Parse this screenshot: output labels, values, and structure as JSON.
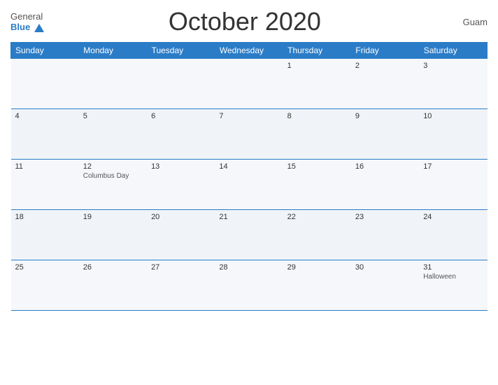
{
  "header": {
    "logo_general": "General",
    "logo_blue": "Blue",
    "title": "October 2020",
    "region": "Guam"
  },
  "weekdays": [
    "Sunday",
    "Monday",
    "Tuesday",
    "Wednesday",
    "Thursday",
    "Friday",
    "Saturday"
  ],
  "weeks": [
    [
      {
        "day": "",
        "event": ""
      },
      {
        "day": "",
        "event": ""
      },
      {
        "day": "",
        "event": ""
      },
      {
        "day": "",
        "event": ""
      },
      {
        "day": "1",
        "event": ""
      },
      {
        "day": "2",
        "event": ""
      },
      {
        "day": "3",
        "event": ""
      }
    ],
    [
      {
        "day": "4",
        "event": ""
      },
      {
        "day": "5",
        "event": ""
      },
      {
        "day": "6",
        "event": ""
      },
      {
        "day": "7",
        "event": ""
      },
      {
        "day": "8",
        "event": ""
      },
      {
        "day": "9",
        "event": ""
      },
      {
        "day": "10",
        "event": ""
      }
    ],
    [
      {
        "day": "11",
        "event": ""
      },
      {
        "day": "12",
        "event": "Columbus Day"
      },
      {
        "day": "13",
        "event": ""
      },
      {
        "day": "14",
        "event": ""
      },
      {
        "day": "15",
        "event": ""
      },
      {
        "day": "16",
        "event": ""
      },
      {
        "day": "17",
        "event": ""
      }
    ],
    [
      {
        "day": "18",
        "event": ""
      },
      {
        "day": "19",
        "event": ""
      },
      {
        "day": "20",
        "event": ""
      },
      {
        "day": "21",
        "event": ""
      },
      {
        "day": "22",
        "event": ""
      },
      {
        "day": "23",
        "event": ""
      },
      {
        "day": "24",
        "event": ""
      }
    ],
    [
      {
        "day": "25",
        "event": ""
      },
      {
        "day": "26",
        "event": ""
      },
      {
        "day": "27",
        "event": ""
      },
      {
        "day": "28",
        "event": ""
      },
      {
        "day": "29",
        "event": ""
      },
      {
        "day": "30",
        "event": ""
      },
      {
        "day": "31",
        "event": "Halloween"
      }
    ]
  ]
}
